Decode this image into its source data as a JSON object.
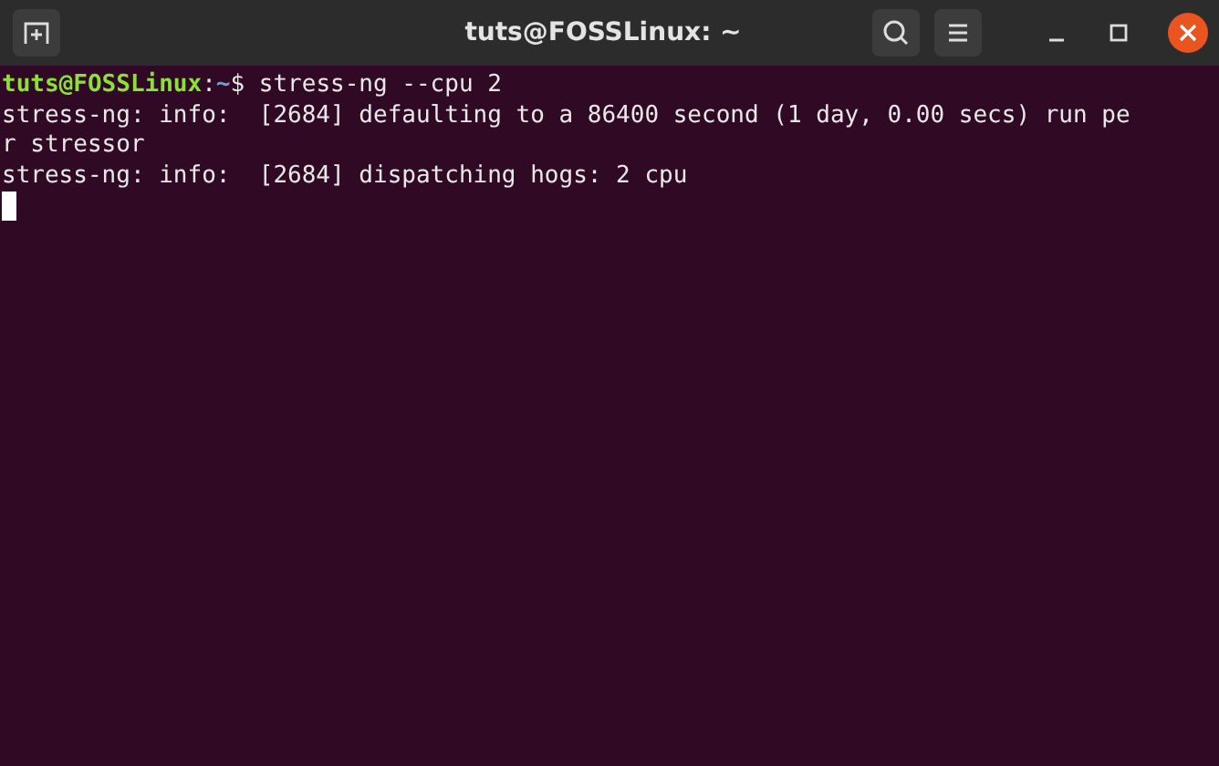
{
  "window": {
    "title": "tuts@FOSSLinux: ~"
  },
  "prompt": {
    "user_host": "tuts@FOSSLinux",
    "separator": ":",
    "path": "~",
    "symbol": "$",
    "command": "stress-ng --cpu 2"
  },
  "output_lines": [
    "stress-ng: info:  [2684] defaulting to a 86400 second (1 day, 0.00 secs) run pe",
    "r stressor",
    "stress-ng: info:  [2684] dispatching hogs: 2 cpu"
  ]
}
